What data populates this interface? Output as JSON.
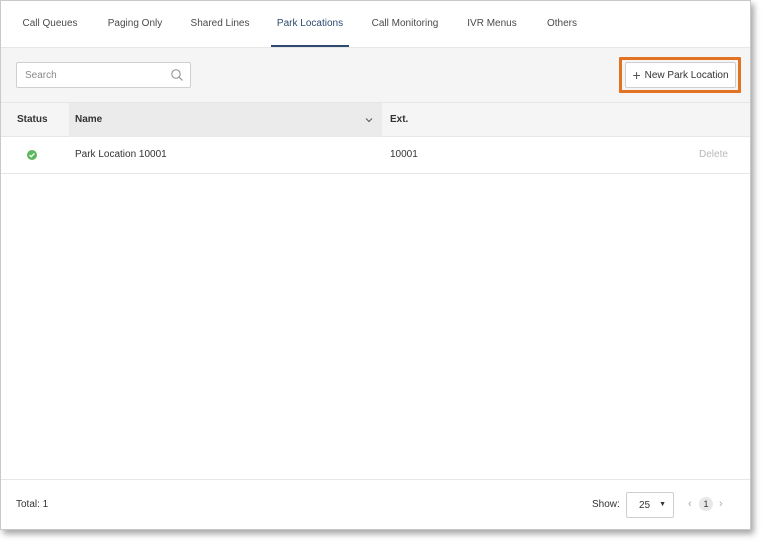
{
  "tabs": [
    {
      "label": "Call Queues"
    },
    {
      "label": "Paging Only"
    },
    {
      "label": "Shared Lines"
    },
    {
      "label": "Park Locations"
    },
    {
      "label": "Call Monitoring"
    },
    {
      "label": "IVR Menus"
    },
    {
      "label": "Others"
    }
  ],
  "active_tab": "Park Locations",
  "toolbar": {
    "search_placeholder": "Search",
    "search_value": "",
    "new_button_label": "New Park Location",
    "highlight_color": "#e27323"
  },
  "table": {
    "columns": [
      "Status",
      "Name",
      "Ext."
    ],
    "rows": [
      {
        "status": "active",
        "name": "Park Location 10001",
        "ext": "10001",
        "action": "Delete"
      }
    ]
  },
  "footer": {
    "total": "Total: 1",
    "show_label": "Show:",
    "page_size": "25",
    "current_page": "1"
  },
  "colors": {
    "accent": "#2d4b6e",
    "status_ok": "#5cb85c"
  },
  "icons": {
    "search": "search-icon",
    "plus": "plus-icon",
    "sort": "chevron-down-icon",
    "status": "check-circle-icon"
  }
}
